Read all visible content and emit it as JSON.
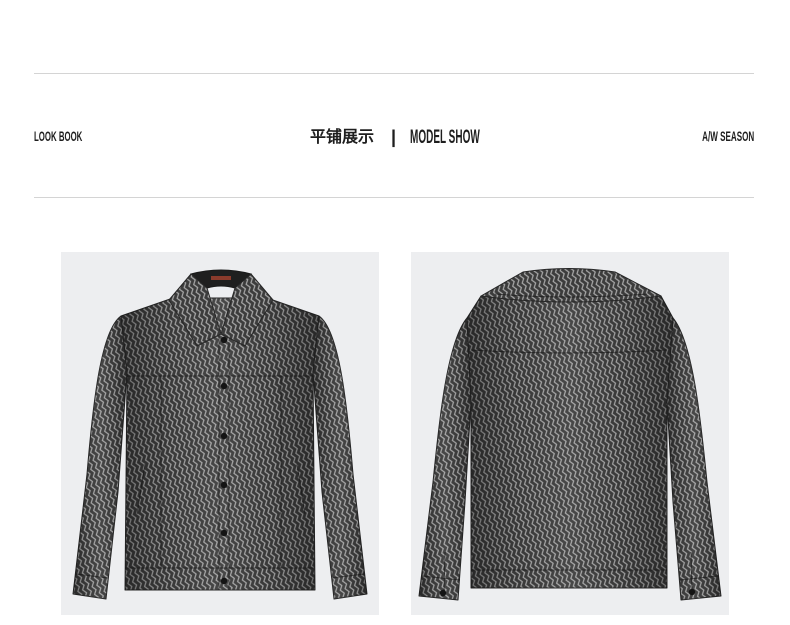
{
  "header": {
    "left_label": "LOOK BOOK",
    "center_cn": "平铺展示",
    "separator": "|",
    "center_en": "MODEL SHOW",
    "right_label": "A/W SEASON"
  },
  "colors": {
    "text": "#1e1e1e",
    "divider": "#d4d4d4",
    "photo_background": "#edeef0",
    "fabric_dark": "#3c3c3c",
    "fabric_light": "#a8a8a8",
    "button": "#141414",
    "brand_tag": "#8b3b2c"
  }
}
